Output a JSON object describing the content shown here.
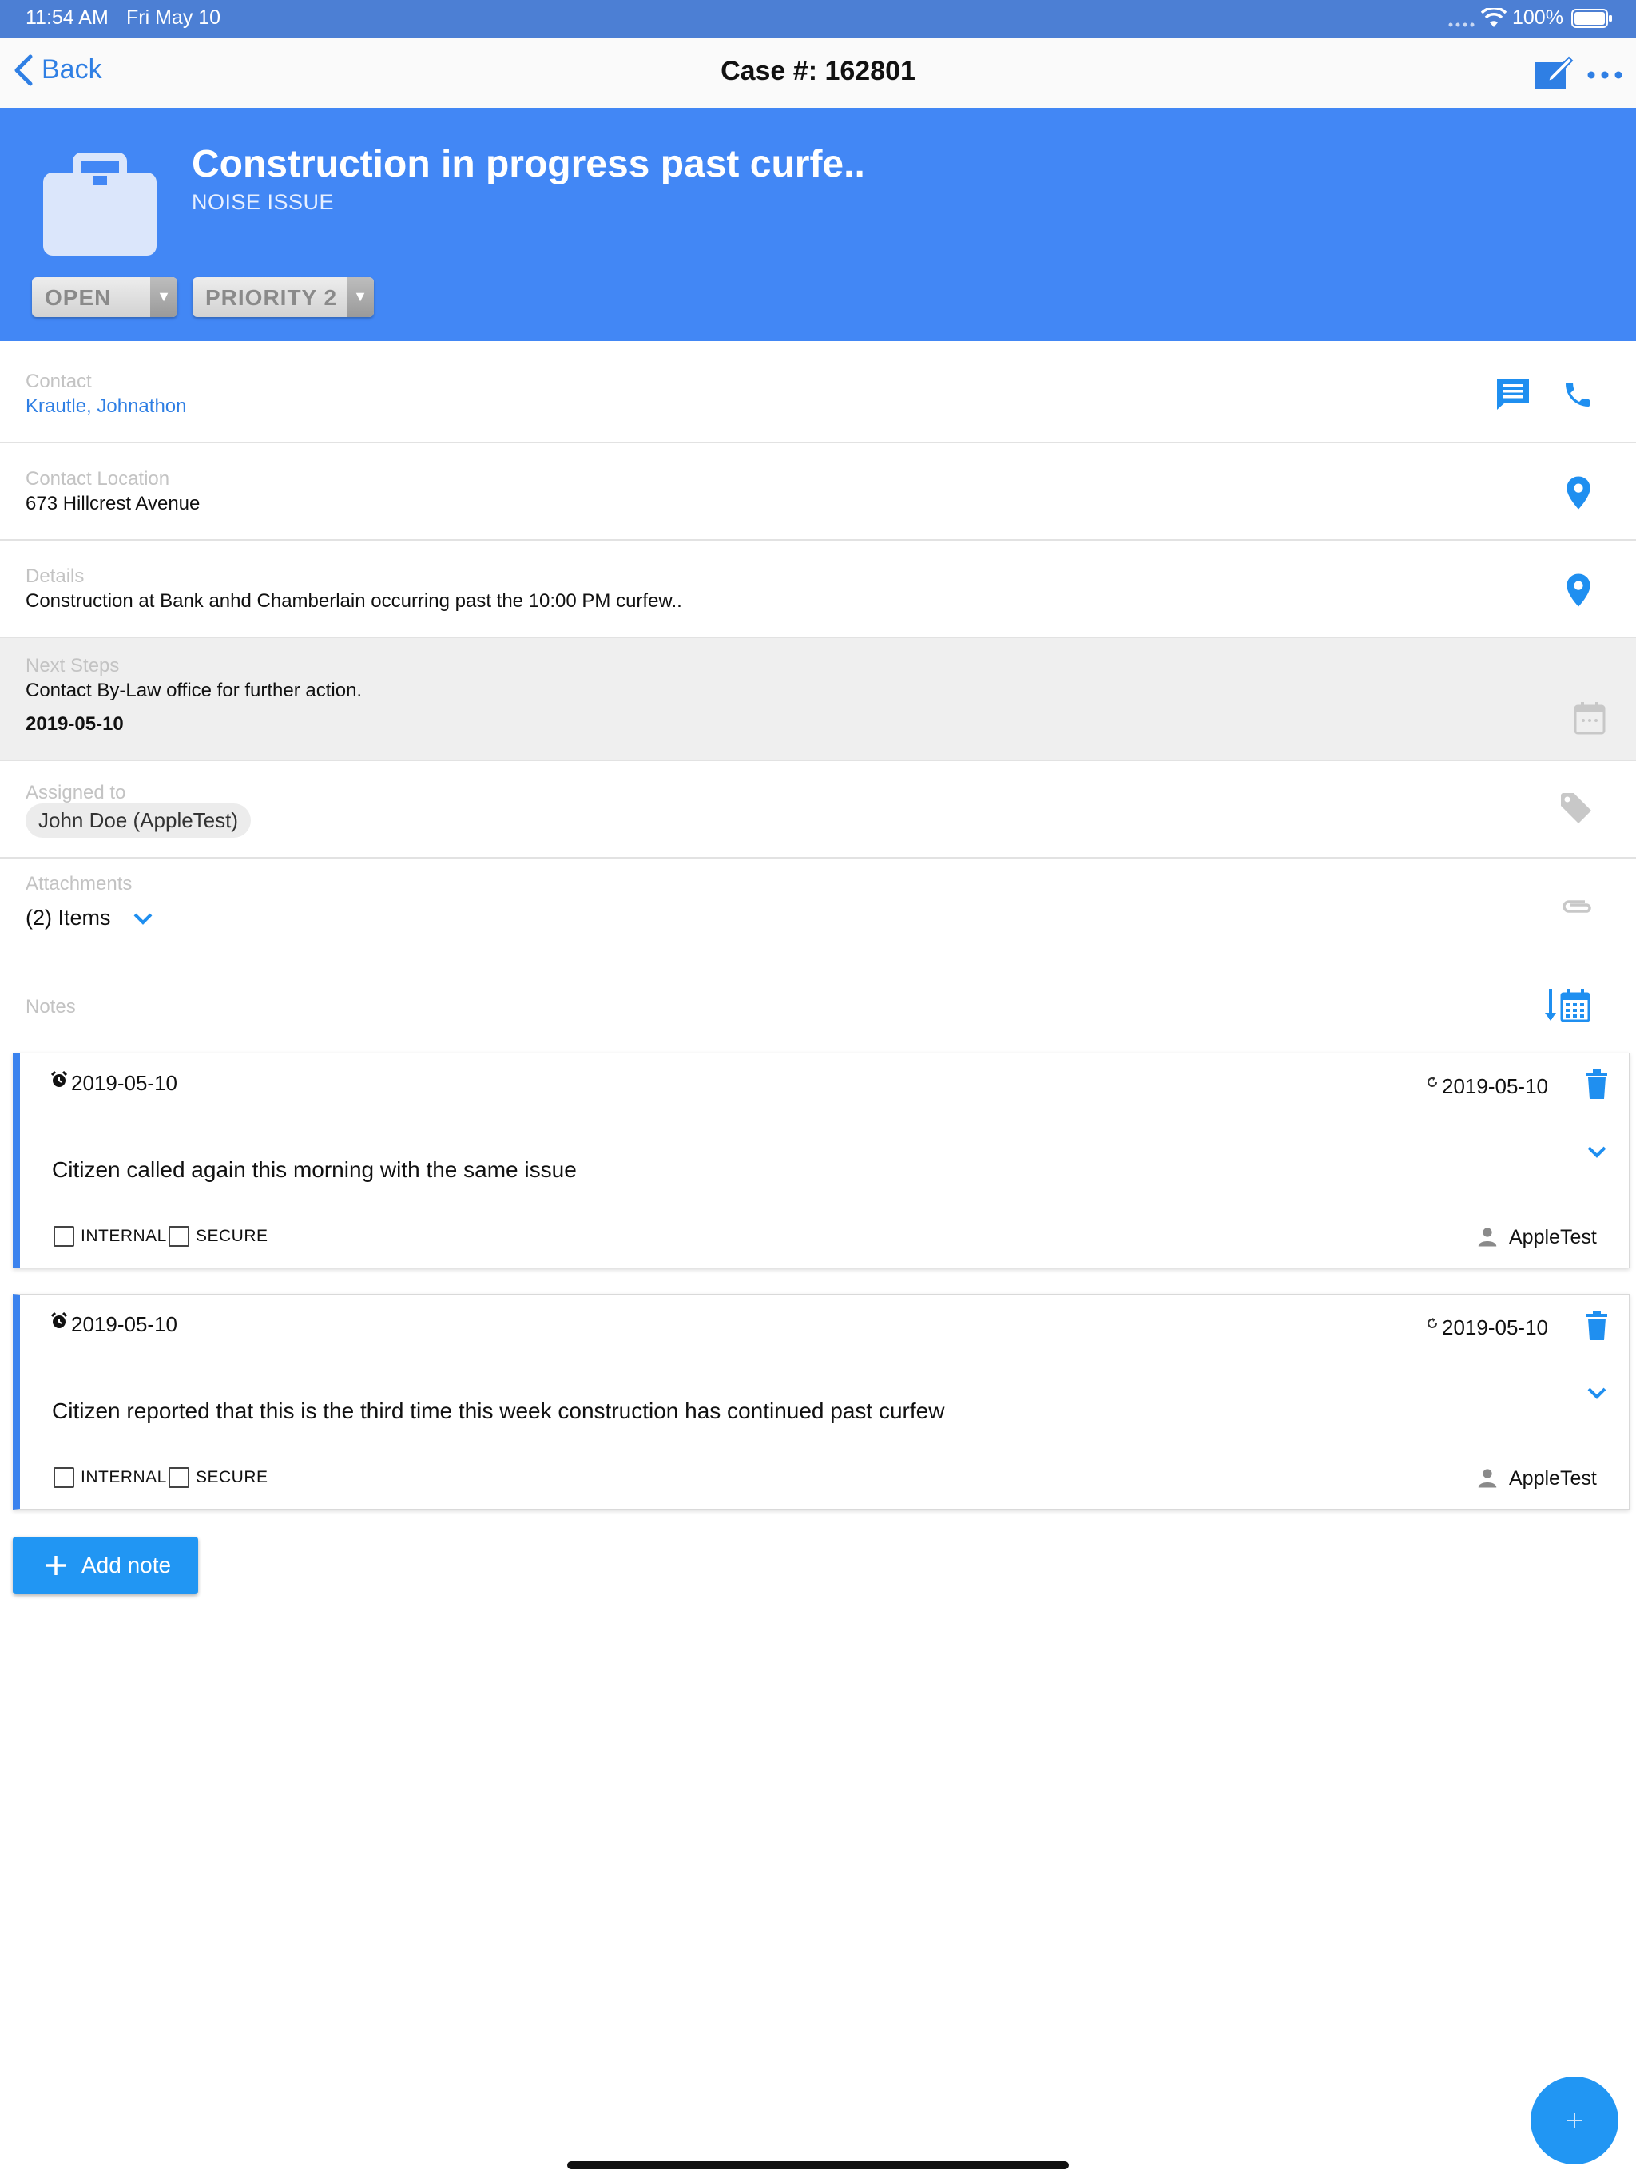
{
  "status_bar": {
    "time": "11:54 AM",
    "date": "Fri May 10",
    "battery": "100%"
  },
  "nav": {
    "back_label": "Back",
    "title": "Case #: 162801"
  },
  "case": {
    "title": "Construction in progress past curfe..",
    "category": "NOISE ISSUE",
    "status": "OPEN",
    "priority": "PRIORITY 2"
  },
  "fields": {
    "contact_label": "Contact",
    "contact_value": "Krautle, Johnathon",
    "location_label": "Contact Location",
    "location_value": "673 Hillcrest Avenue",
    "details_label": "Details",
    "details_value": "Construction at Bank anhd Chamberlain occurring past the 10:00 PM curfew..",
    "next_steps_label": "Next Steps",
    "next_steps_value": "Contact By-Law office for further action.",
    "next_steps_date": "2019-05-10",
    "assigned_label": "Assigned to",
    "assigned_value": "John Doe (AppleTest)",
    "attachments_label": "Attachments",
    "attachments_value": "(2) Items",
    "notes_label": "Notes"
  },
  "notes": [
    {
      "created": "2019-05-10",
      "updated": "2019-05-10",
      "text": "Citizen called again this morning with the same issue",
      "internal_label": "INTERNAL",
      "secure_label": "SECURE",
      "author": "AppleTest"
    },
    {
      "created": "2019-05-10",
      "updated": "2019-05-10",
      "text": "Citizen reported that this is the third time this week construction has continued past curfew",
      "internal_label": "INTERNAL",
      "secure_label": "SECURE",
      "author": "AppleTest"
    }
  ],
  "add_note_label": "Add note",
  "colors": {
    "header": "#4287f5",
    "accent": "#2196f3",
    "status_bar": "#4c7fd4"
  }
}
